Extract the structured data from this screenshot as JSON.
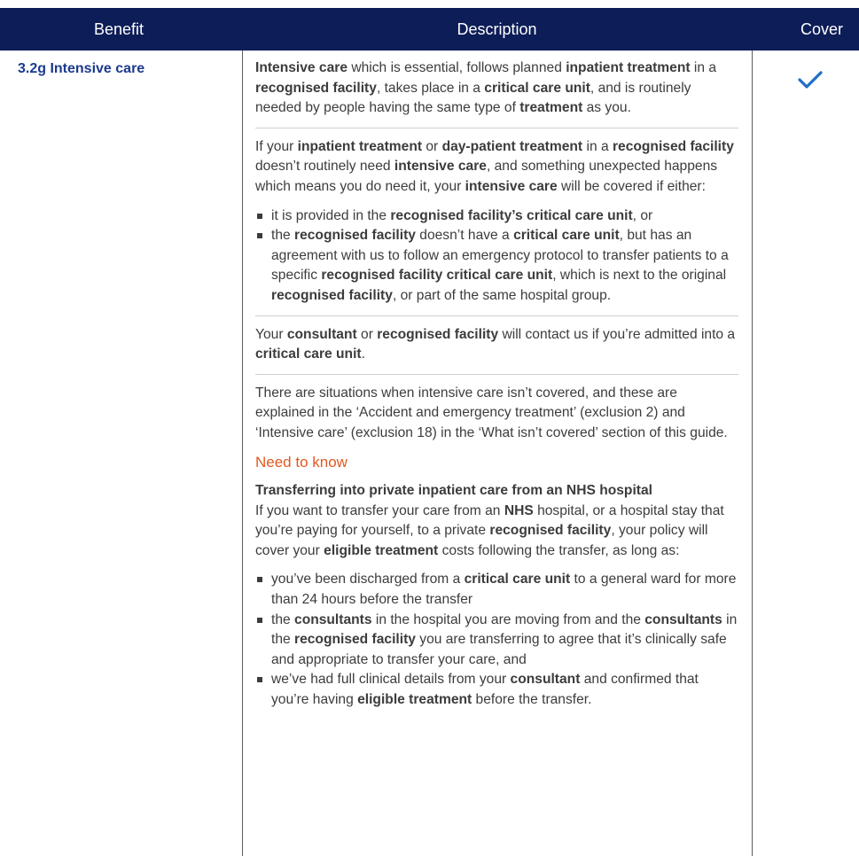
{
  "header": {
    "benefit": "Benefit",
    "description": "Description",
    "cover": "Cover"
  },
  "row": {
    "benefit_label": "3.2g Intensive care",
    "cover_icon": "checkmark-icon",
    "accent_color": "#1b3a8c",
    "header_color": "#0c1d57",
    "heading_color": "#e25822",
    "para1": [
      {
        "t": "Intensive care",
        "b": true
      },
      {
        "t": " which is essential, follows planned "
      },
      {
        "t": "inpatient treatment",
        "b": true
      },
      {
        "t": " in a "
      },
      {
        "t": "recognised facility",
        "b": true
      },
      {
        "t": ", takes place in a "
      },
      {
        "t": "critical care unit",
        "b": true
      },
      {
        "t": ", and is routinely needed by people having the same type of "
      },
      {
        "t": "treatment",
        "b": true
      },
      {
        "t": " as you."
      }
    ],
    "para2": [
      {
        "t": "If your "
      },
      {
        "t": "inpatient treatment",
        "b": true
      },
      {
        "t": " or "
      },
      {
        "t": "day-patient treatment",
        "b": true
      },
      {
        "t": " in a "
      },
      {
        "t": "recognised facility",
        "b": true
      },
      {
        "t": " doesn’t routinely need "
      },
      {
        "t": "intensive care",
        "b": true
      },
      {
        "t": ", and something unexpected happens which means you do need it, your "
      },
      {
        "t": "intensive care",
        "b": true
      },
      {
        "t": " will be covered if either:"
      }
    ],
    "list1": [
      [
        {
          "t": "it is provided in the "
        },
        {
          "t": "recognised facility’s critical care unit",
          "b": true
        },
        {
          "t": ", or"
        }
      ],
      [
        {
          "t": "the "
        },
        {
          "t": "recognised facility",
          "b": true
        },
        {
          "t": " doesn’t have a "
        },
        {
          "t": "critical care unit",
          "b": true
        },
        {
          "t": ", but has an agreement with us to follow an emergency protocol to transfer patients to a specific "
        },
        {
          "t": "recognised facility critical care unit",
          "b": true
        },
        {
          "t": ", which is next to the original "
        },
        {
          "t": "recognised facility",
          "b": true
        },
        {
          "t": ", or part of the same hospital group."
        }
      ]
    ],
    "para3": [
      {
        "t": "Your "
      },
      {
        "t": "consultant",
        "b": true
      },
      {
        "t": " or "
      },
      {
        "t": "recognised facility",
        "b": true
      },
      {
        "t": " will contact us if you’re admitted into a "
      },
      {
        "t": "critical care unit",
        "b": true
      },
      {
        "t": "."
      }
    ],
    "para4": [
      {
        "t": "There are situations when intensive care isn’t covered, and these are explained in the ‘Accident and emergency treatment’ (exclusion 2) and ‘Intensive care’ (exclusion 18) in the ‘What isn’t covered’ section of this guide."
      }
    ],
    "need_to_know": "Need to know",
    "ntk_title": "Transferring into private inpatient care from an NHS hospital",
    "para5": [
      {
        "t": "If you want to transfer your care from an "
      },
      {
        "t": "NHS",
        "b": true
      },
      {
        "t": " hospital, or a hospital stay that you’re paying for yourself, to a private "
      },
      {
        "t": "recognised facility",
        "b": true
      },
      {
        "t": ", your policy will cover your "
      },
      {
        "t": "eligible treatment",
        "b": true
      },
      {
        "t": " costs following the transfer, as long as:"
      }
    ],
    "list2": [
      [
        {
          "t": "you’ve been discharged from a "
        },
        {
          "t": "critical care unit",
          "b": true
        },
        {
          "t": " to a general ward for more than 24 hours before the transfer"
        }
      ],
      [
        {
          "t": "the "
        },
        {
          "t": "consultants",
          "b": true
        },
        {
          "t": " in the hospital you are moving from and the "
        },
        {
          "t": "consultants",
          "b": true
        },
        {
          "t": " in the "
        },
        {
          "t": "recognised facility",
          "b": true
        },
        {
          "t": " you are transferring to agree that it’s clinically safe and appropriate to transfer your care, and"
        }
      ],
      [
        {
          "t": "we’ve had full clinical details from your "
        },
        {
          "t": "consultant",
          "b": true
        },
        {
          "t": " and confirmed that you’re having "
        },
        {
          "t": "eligible treatment",
          "b": true
        },
        {
          "t": " before the transfer."
        }
      ]
    ]
  }
}
